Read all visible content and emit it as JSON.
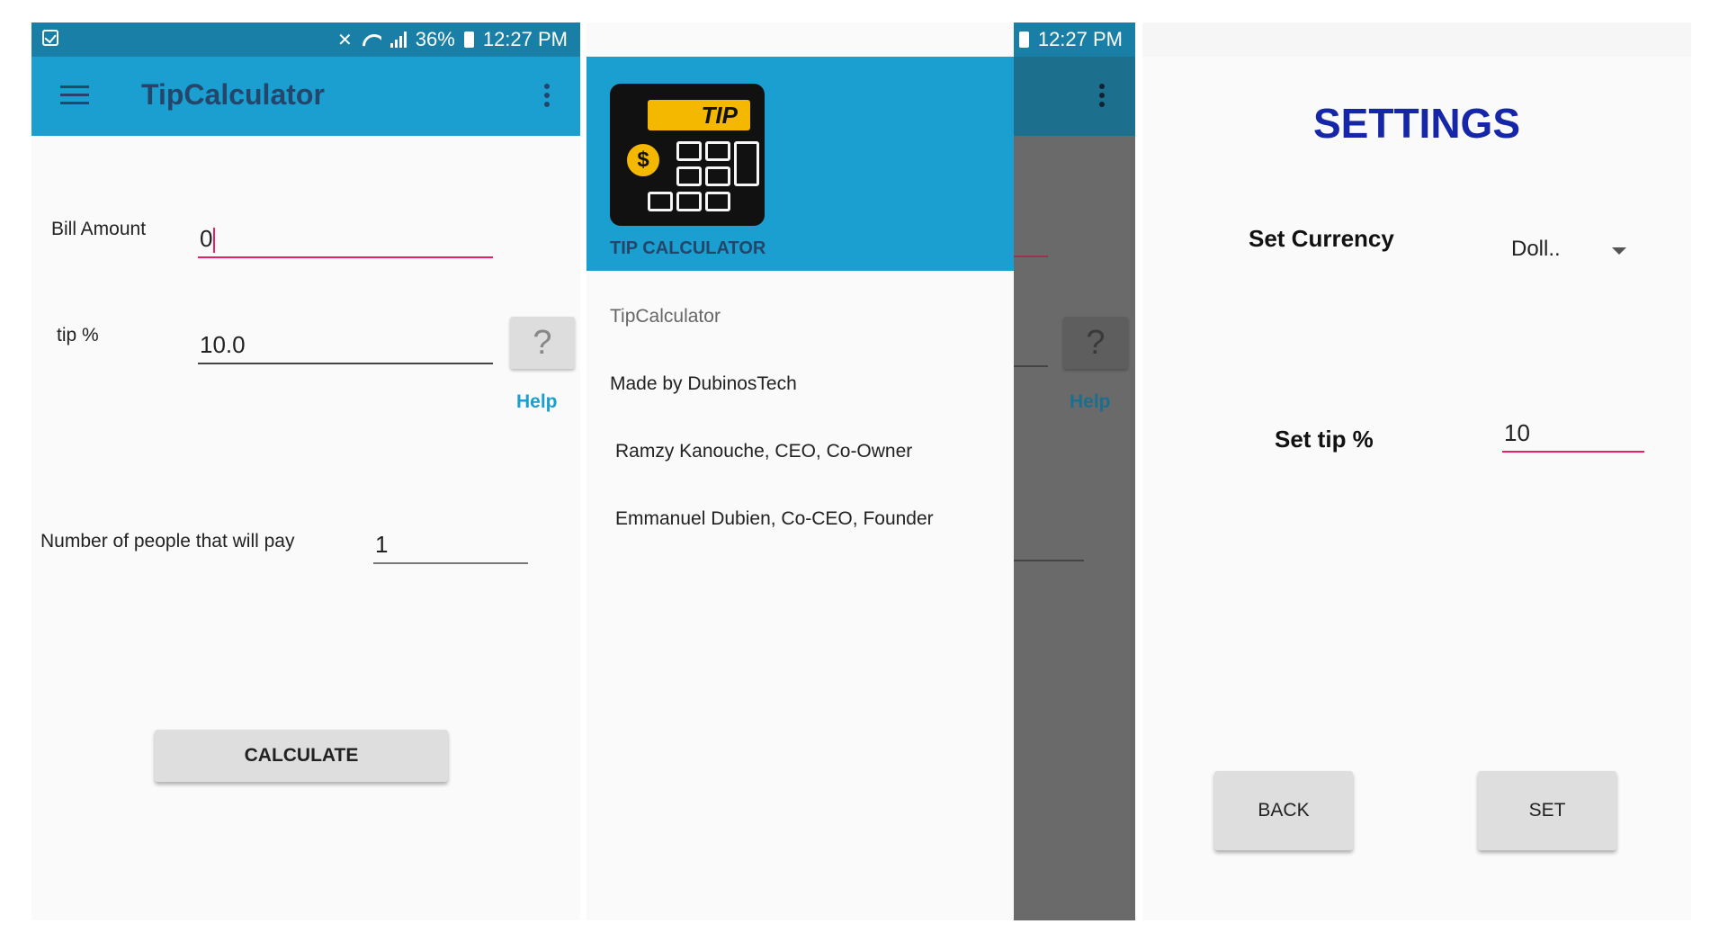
{
  "status_bar": {
    "battery": "36%",
    "time": "12:27 PM"
  },
  "main_screen": {
    "app_title": "TipCalculator",
    "bill_label": "Bill Amount",
    "bill_value": "0",
    "tip_label": "tip %",
    "tip_value": "10.0",
    "help_icon_glyph": "?",
    "help_link": "Help",
    "people_label": "Number of people that will pay",
    "people_value": "1",
    "calculate_button": "CALCULATE"
  },
  "drawer_screen": {
    "logo_display": "TIP",
    "logo_coin": "$",
    "header_title": "TIP CALCULATOR",
    "items": [
      "TipCalculator",
      "Made by DubinosTech",
      "Ramzy Kanouche, CEO, Co-Owner",
      "Emmanuel Dubien, Co-CEO, Founder"
    ],
    "behind_help_link": "Help",
    "behind_help_glyph": "?"
  },
  "settings_screen": {
    "title": "SETTINGS",
    "currency_label": "Set Currency",
    "currency_selected": "Doll..",
    "tip_label": "Set  tip %",
    "tip_value": "10",
    "back_button": "BACK",
    "set_button": "SET"
  },
  "colors": {
    "status_bar": "#1a7fa6",
    "app_bar": "#1a9fd0",
    "title_text": "#24466a",
    "accent_pink": "#e91e63",
    "settings_title": "#1526a8",
    "logo_yellow": "#f5b800"
  },
  "icons": [
    "checkbox-notification-icon",
    "mute-icon",
    "wifi-icon",
    "signal-icon",
    "battery-icon",
    "hamburger-menu-icon",
    "overflow-menu-icon",
    "question-mark-icon",
    "calculator-logo-icon",
    "dropdown-arrow-icon"
  ]
}
